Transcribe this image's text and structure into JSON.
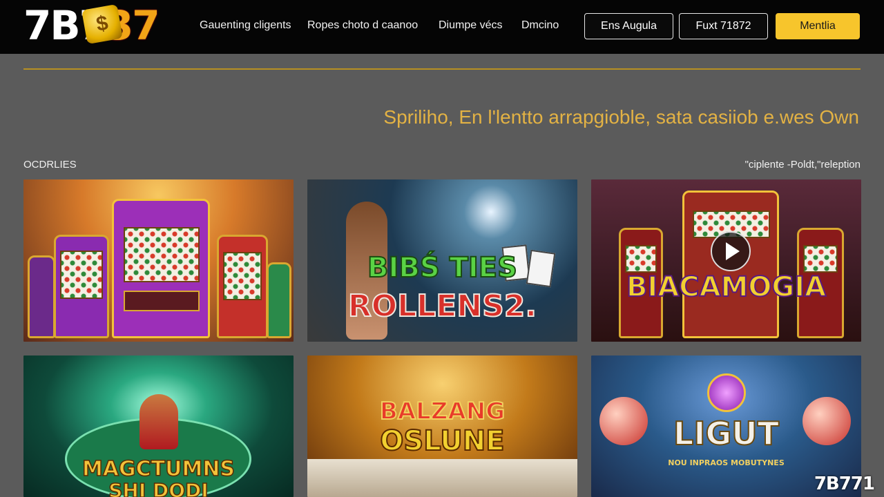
{
  "header": {
    "logo_text": "7B7",
    "logo_accent": "37",
    "nav": [
      "Gauenting cligents",
      "Ropes choto d caanoo",
      "Diumpe vécs",
      "Dmcino"
    ],
    "btn_login": "Ens Augula",
    "btn_register": "Fuxt 71872",
    "btn_cta": "Mentlia"
  },
  "hero": {
    "tagline": "Sprilihо, En l'lentto arrapgioble, sata casiiob e.wes Own"
  },
  "section": {
    "label": "OCDRLIES",
    "right_text": "\"ciplente -Poldt,\"releption"
  },
  "games": [
    {
      "title": "",
      "has_play": false
    },
    {
      "title_line1": "BIBŚ TIES",
      "title_line2": "ROLLENS2.",
      "has_play": false
    },
    {
      "title": "BIACAMOGIA",
      "has_play": true
    },
    {
      "title_line1": "MAGCTUMNS",
      "title_line2": "SHI DODI",
      "has_play": false
    },
    {
      "title_line1": "BALZANG",
      "title_line2": "OSLUNE",
      "has_play": false
    },
    {
      "title": "LIGUT",
      "subtitle": "NOU INPRAOS MOBUTYNES",
      "has_play": false
    }
  ],
  "watermark": "7B771",
  "colors": {
    "accent_gold": "#f7c52c",
    "hero_text": "#e3b244",
    "background": "#5b5b5b",
    "header_bg": "#050505"
  }
}
